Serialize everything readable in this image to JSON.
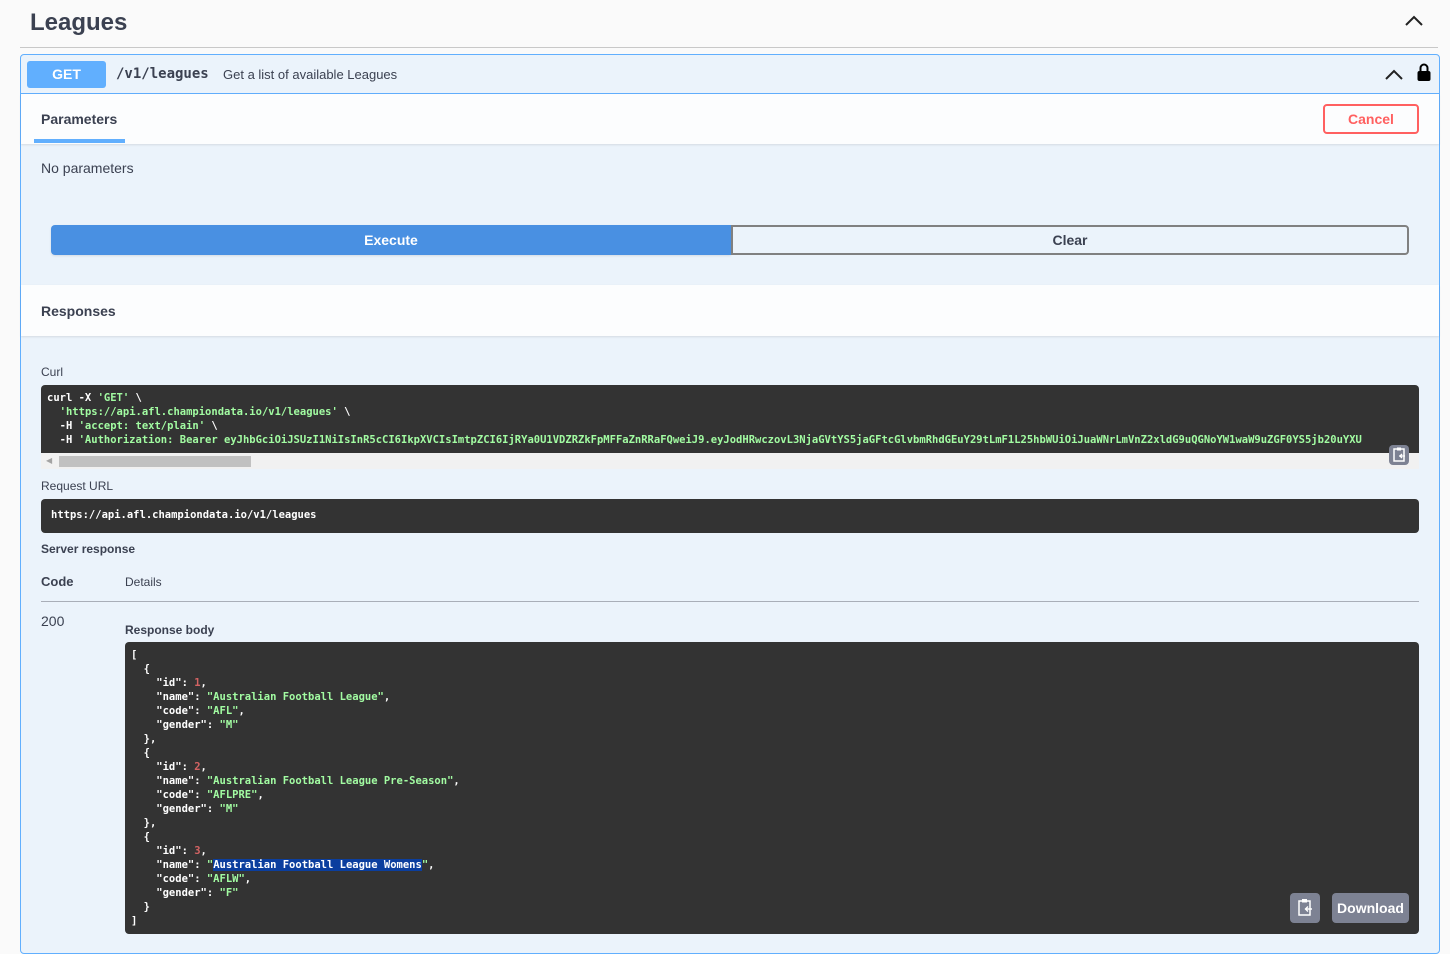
{
  "tag": {
    "title": "Leagues",
    "collapse_icon": "chevron-up-icon"
  },
  "operation": {
    "method": "GET",
    "path": "/v1/leagues",
    "summary": "Get a list of available Leagues",
    "lock_icon": "lock-icon"
  },
  "parameters": {
    "tab_label": "Parameters",
    "cancel_label": "Cancel",
    "empty_text": "No parameters"
  },
  "actions": {
    "execute_label": "Execute",
    "clear_label": "Clear"
  },
  "responses": {
    "title": "Responses",
    "curl_label": "Curl",
    "curl_lines": [
      "curl -X 'GET' \\",
      "  'https://api.afl.championdata.io/v1/leagues' \\",
      "  -H 'accept: text/plain' \\",
      "  -H 'Authorization: Bearer eyJhbGciOiJSUzI1NiIsInR5cCI6IkpXVCIsImtpZCI6IjRYa0U1VDZRZkFpMFFaZnRRaFQweiJ9.eyJodHRwczovL3NjaGVtYS5jaGFtcGlvbmRhdGEuY29tLmF1L25hbWUiOiJuaWNrLmVnZ2xldG9uQGNoYW1waW9uZGF0YS5jb20uYXU"
    ],
    "request_url_label": "Request URL",
    "request_url": "https://api.afl.championdata.io/v1/leagues",
    "server_response_label": "Server response",
    "code_header": "Code",
    "details_header": "Details",
    "status_code": "200",
    "response_body_label": "Response body",
    "download_label": "Download",
    "leagues": [
      {
        "id": 1,
        "name": "Australian Football League",
        "code": "AFL",
        "gender": "M"
      },
      {
        "id": 2,
        "name": "Australian Football League Pre-Season",
        "code": "AFLPRE",
        "gender": "M"
      },
      {
        "id": 3,
        "name": "Australian Football League Womens",
        "code": "AFLW",
        "gender": "F",
        "selected": true
      }
    ]
  },
  "colors": {
    "get_method": "#61affe",
    "execute": "#4990e2",
    "cancel": "#ff6060",
    "code_bg": "#333333",
    "string": "#a2fca2",
    "number": "#d36363"
  }
}
